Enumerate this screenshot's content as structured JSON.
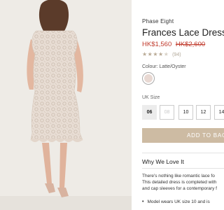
{
  "product": {
    "brand": "Phase Eight",
    "title": "Frances Lace Dress",
    "price_now": "HK$1,560",
    "price_was": "HK$2,600",
    "rating_stars": 4,
    "rating_max": 5,
    "review_count": "(94)"
  },
  "colour": {
    "label": "Colour: Latte/Oyster",
    "swatch_color": "#e8d8d2"
  },
  "size": {
    "label": "UK Size",
    "options": [
      {
        "label": "06",
        "state": "selected"
      },
      {
        "label": "08",
        "state": "unavailable"
      },
      {
        "label": "10",
        "state": "available"
      },
      {
        "label": "12",
        "state": "available"
      },
      {
        "label": "14",
        "state": "available"
      }
    ]
  },
  "cart": {
    "add_label": "ADD TO BAG",
    "button_color": "#cdbba3"
  },
  "details": {
    "heading": "Why We Love It",
    "lines": [
      "There's nothing like romantic lace fo",
      "This detailed dress is completed with",
      "and cap sleeves for a contemporary f"
    ],
    "bullet": "Model wears UK size 10 and is"
  },
  "icons": {
    "star": "star-icon",
    "bullet": "bullet-dot-icon"
  }
}
